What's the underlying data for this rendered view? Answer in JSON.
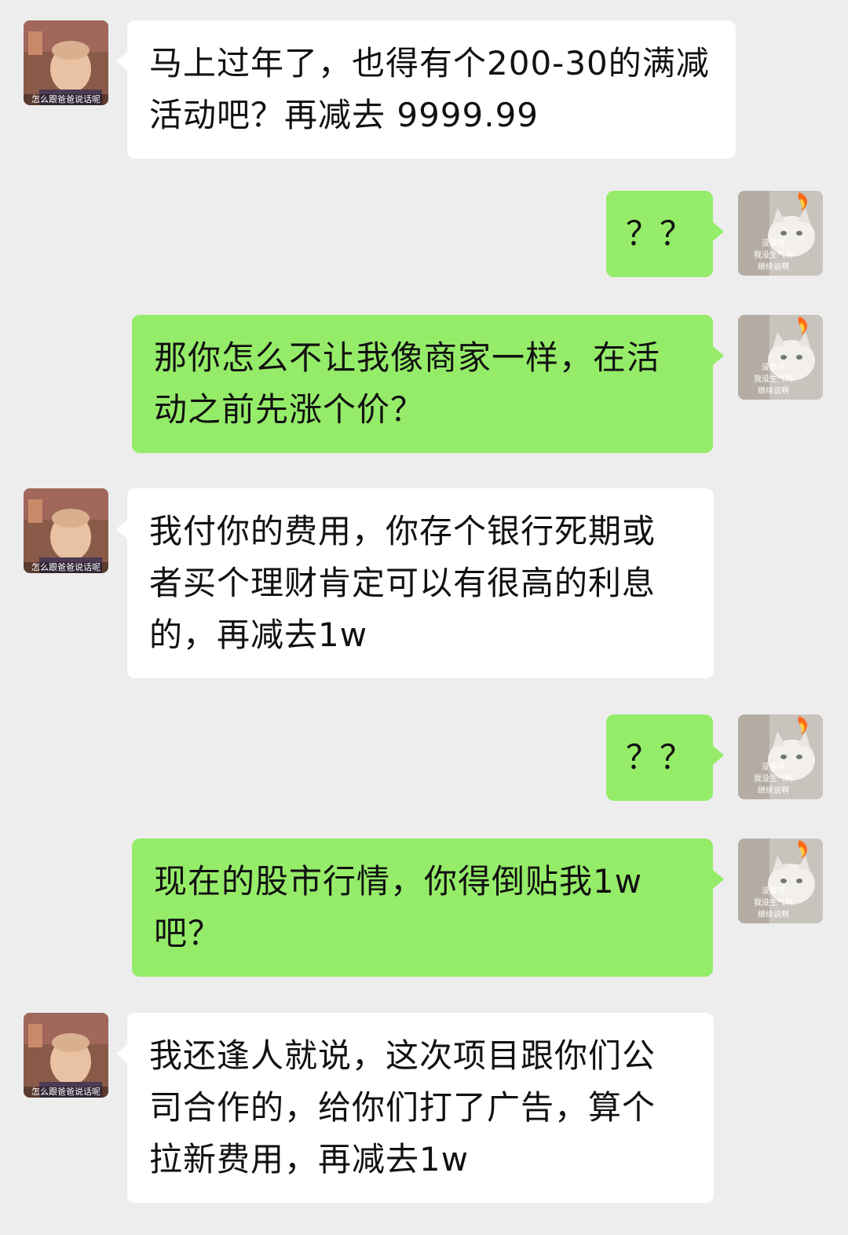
{
  "avatars": {
    "contact": {
      "caption": "怎么跟爸爸说话呢",
      "icon": "man-portrait-avatar"
    },
    "me": {
      "caption_lines": [
        "没事啊",
        "我没生气啊",
        "继续说啊"
      ],
      "icon": "cat-fire-avatar"
    }
  },
  "colors": {
    "background": "#ededed",
    "incoming_bubble": "#ffffff",
    "outgoing_bubble": "#95ec69"
  },
  "messages": [
    {
      "from": "contact",
      "text": "马上过年了，也得有个200-30的满减\n活动吧？再减去 9999.99"
    },
    {
      "from": "me",
      "text": "？？"
    },
    {
      "from": "me",
      "text": "那你怎么不让我像商家一样，在活\n动之前先涨个价？"
    },
    {
      "from": "contact",
      "text": "我付你的费用，你存个银行死期或\n者买个理财肯定可以有很高的利息\n的，再减去1w"
    },
    {
      "from": "me",
      "text": "？？"
    },
    {
      "from": "me",
      "text": "现在的股市行情，你得倒贴我1w\n吧？"
    },
    {
      "from": "contact",
      "text": "我还逢人就说，这次项目跟你们公\n司合作的，给你们打了广告，算个\n拉新费用，再减去1w"
    }
  ]
}
